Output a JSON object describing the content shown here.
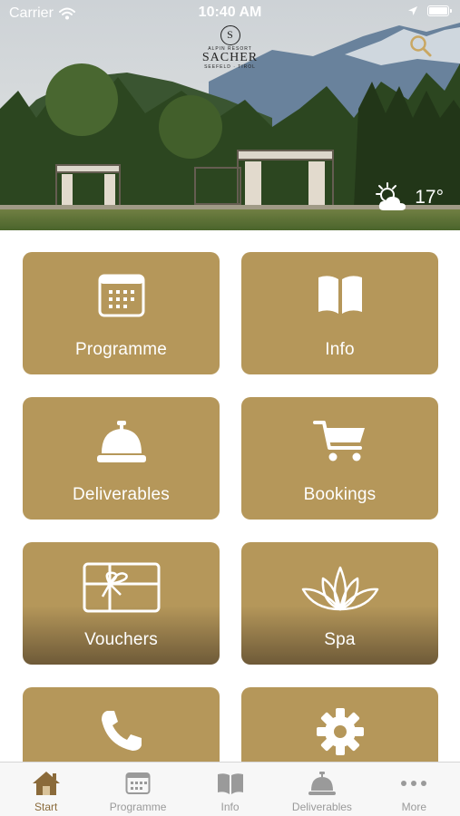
{
  "status_bar": {
    "carrier": "Carrier",
    "time": "10:40 AM"
  },
  "header": {
    "logo": {
      "monogram": "S",
      "line1": "ALPIN RESORT",
      "line2": "SACHER",
      "line3": "SEEFELD · TIROL"
    },
    "weather": {
      "temperature": "17°",
      "icon": "partly-sunny-icon"
    }
  },
  "tiles": [
    {
      "label": "Programme",
      "icon": "calendar-icon"
    },
    {
      "label": "Info",
      "icon": "book-icon"
    },
    {
      "label": "Deliverables",
      "icon": "service-bell-icon"
    },
    {
      "label": "Bookings",
      "icon": "shopping-cart-icon"
    },
    {
      "label": "Vouchers",
      "icon": "gift-card-icon"
    },
    {
      "label": "Spa",
      "icon": "lotus-icon"
    },
    {
      "label": "",
      "icon": "phone-icon"
    },
    {
      "label": "",
      "icon": "gear-icon"
    }
  ],
  "tabbar": {
    "items": [
      {
        "label": "Start",
        "icon": "home-icon",
        "active": true
      },
      {
        "label": "Programme",
        "icon": "calendar-icon",
        "active": false
      },
      {
        "label": "Info",
        "icon": "book-icon",
        "active": false
      },
      {
        "label": "Deliverables",
        "icon": "service-bell-icon",
        "active": false
      },
      {
        "label": "More",
        "icon": "more-dots-icon",
        "active": false
      }
    ]
  },
  "colors": {
    "tile": "#b5975a",
    "tab_active": "#8a6a3a",
    "tab_inactive": "#9a9a9a"
  }
}
